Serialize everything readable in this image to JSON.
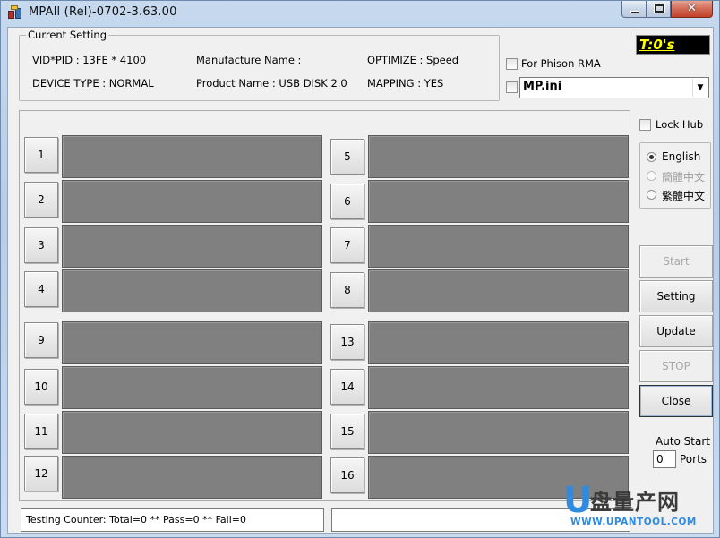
{
  "window": {
    "title": "MPAll (Rel)-0702-3.63.00",
    "close_glyph": "✕"
  },
  "current_setting": {
    "legend": "Current Setting",
    "vid_pid": "VID*PID : 13FE * 4100",
    "device_type": "DEVICE TYPE : NORMAL",
    "manufacture_name": "Manufacture Name :",
    "product_name": "Product Name : USB DISK 2.0",
    "optimize": "OPTIMIZE : Speed",
    "mapping": "MAPPING : YES"
  },
  "options": {
    "for_phison_rma": "For Phison RMA",
    "for_phison_rma_checked": false,
    "ini_checked": false,
    "ini_file": "MP.ini",
    "lock_hub": "Lock Hub",
    "lock_hub_checked": false
  },
  "timer": "T:0's",
  "ports": [
    {
      "label": "1"
    },
    {
      "label": "2"
    },
    {
      "label": "3"
    },
    {
      "label": "4"
    },
    {
      "label": "5"
    },
    {
      "label": "6"
    },
    {
      "label": "7"
    },
    {
      "label": "8"
    },
    {
      "label": "9"
    },
    {
      "label": "10"
    },
    {
      "label": "11"
    },
    {
      "label": "12"
    },
    {
      "label": "13"
    },
    {
      "label": "14"
    },
    {
      "label": "15"
    },
    {
      "label": "16"
    }
  ],
  "language": {
    "english": "English",
    "simplified": "簡體中文",
    "traditional": "繁體中文",
    "selected": "English"
  },
  "buttons": {
    "start": "Start",
    "setting": "Setting",
    "update": "Update",
    "stop": "STOP",
    "close": "Close"
  },
  "auto_start": {
    "label": "Auto Start",
    "value": "0",
    "ports_label": "Ports"
  },
  "status": {
    "counter": "Testing Counter: Total=0 ** Pass=0 ** Fail=0"
  },
  "watermark": {
    "logo_letter": "U",
    "brand": "盘量产网",
    "url": "WWW.UPANTOOL.COM"
  },
  "colors": {
    "port_bar": "#808080",
    "timer_bg": "#000000",
    "timer_fg": "#ffff00",
    "watermark_blue": "#2e8be0"
  }
}
